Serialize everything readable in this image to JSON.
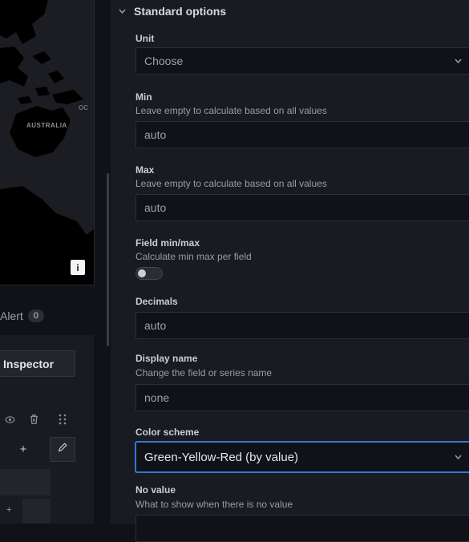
{
  "left": {
    "map_label": "AUSTRALIA",
    "map_label_partial": "OC",
    "info_button": "i",
    "alert_tab": {
      "label": "Alert",
      "count": "0"
    },
    "inspector_button": "Inspector",
    "icons": [
      "eye-icon",
      "trash-icon",
      "drag-handle-icon"
    ],
    "plus_label": "+",
    "plus_small": "+"
  },
  "panel": {
    "section": "Standard options",
    "unit": {
      "label": "Unit",
      "value": "Choose"
    },
    "min": {
      "label": "Min",
      "desc": "Leave empty to calculate based on all values",
      "value": "auto"
    },
    "max": {
      "label": "Max",
      "desc": "Leave empty to calculate based on all values",
      "value": "auto"
    },
    "field_minmax": {
      "label": "Field min/max",
      "desc": "Calculate min max per field",
      "enabled": false
    },
    "decimals": {
      "label": "Decimals",
      "value": "auto"
    },
    "display_name": {
      "label": "Display name",
      "desc": "Change the field or series name",
      "value": "none"
    },
    "color_scheme": {
      "label": "Color scheme",
      "value": "Green-Yellow-Red (by value)"
    },
    "no_value": {
      "label": "No value",
      "desc": "What to show when there is no value"
    }
  },
  "colors": {
    "accent": "#3d71d9",
    "panel_bg": "#181b1f",
    "input_bg": "#111217"
  }
}
